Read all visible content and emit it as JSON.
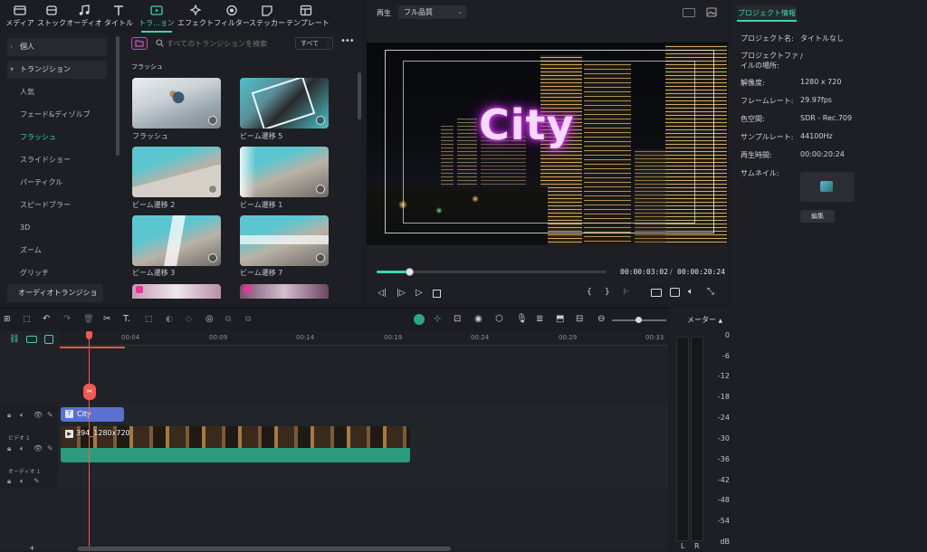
{
  "toolbar": {
    "tabs": [
      {
        "label": "メディア",
        "icon": "media-icon"
      },
      {
        "label": "ストック",
        "icon": "stock-icon"
      },
      {
        "label": "オーディオ",
        "icon": "audio-icon"
      },
      {
        "label": "タイトル",
        "icon": "title-icon"
      },
      {
        "label": "トラ...ョン",
        "icon": "transition-icon"
      },
      {
        "label": "エフェクト",
        "icon": "effect-icon"
      },
      {
        "label": "フィルター",
        "icon": "filter-icon"
      },
      {
        "label": "ステッカー",
        "icon": "sticker-icon"
      },
      {
        "label": "テンプレート",
        "icon": "template-icon"
      }
    ],
    "active_tab": "トラ...ョン",
    "accent": "#3fd4b3"
  },
  "sidebar": {
    "items": [
      {
        "label": "個人",
        "type": "header"
      },
      {
        "label": "トランジション",
        "type": "header"
      },
      {
        "label": "人気",
        "type": "item"
      },
      {
        "label": "フェード&ディゾルブ",
        "type": "item"
      },
      {
        "label": "フラッシュ",
        "type": "selected"
      },
      {
        "label": "スライドショー",
        "type": "item"
      },
      {
        "label": "パーティクル",
        "type": "item"
      },
      {
        "label": "スピードブラー",
        "type": "item"
      },
      {
        "label": "3D",
        "type": "item"
      },
      {
        "label": "ズーム",
        "type": "item"
      },
      {
        "label": "グリッチ",
        "type": "item"
      },
      {
        "label": "オーディオトランジション",
        "type": "header"
      }
    ]
  },
  "library": {
    "search_placeholder": "すべてのトランジションを検索",
    "filter_label": "すべて",
    "section_title": "フラッシュ",
    "items": [
      {
        "label": "フラッシュ"
      },
      {
        "label": "ビーム遷移 5"
      },
      {
        "label": "ビーム遷移 2"
      },
      {
        "label": "ビーム遷移 1"
      },
      {
        "label": "ビーム遷移 3"
      },
      {
        "label": "ビーム遷移 7"
      }
    ]
  },
  "player": {
    "play_label": "再生",
    "quality": "フル品質",
    "overlay_text": "City",
    "current_time": "00:00:03:02",
    "separator": "/",
    "total_time": "00:00:20:24",
    "progress": 0.14
  },
  "properties": {
    "tab_label": "プロジェクト情報",
    "rows": [
      {
        "key": "プロジェクト名:",
        "value": "タイトルなし"
      },
      {
        "key": "プロジェクトファイルの場所:",
        "value": "/"
      },
      {
        "key": "解像度:",
        "value": "1280 x 720"
      },
      {
        "key": "フレームレート:",
        "value": "29.97fps"
      },
      {
        "key": "色空間:",
        "value": "SDR - Rec.709"
      },
      {
        "key": "サンプルレート:",
        "value": "44100Hz"
      },
      {
        "key": "再生時間:",
        "value": "00:00:20:24"
      },
      {
        "key": "サムネイル:",
        "value": ""
      }
    ],
    "edit_button": "編集"
  },
  "timeline": {
    "ruler": [
      "00:04",
      "00:09",
      "00:14",
      "00:19",
      "00:24",
      "00:29",
      "00:33"
    ],
    "meter_label": "メーター",
    "meter_scale": [
      "0",
      "-6",
      "-12",
      "-18",
      "-24",
      "-30",
      "-36",
      "-42",
      "-48",
      "-54",
      "dB"
    ],
    "meter_channels": [
      "L",
      "R"
    ],
    "tracks": [
      {
        "label": ""
      },
      {
        "label": "ビデオ 1"
      },
      {
        "label": "オーディオ 1"
      }
    ],
    "title_clip": "City",
    "video_clip": "394_1280x720"
  }
}
